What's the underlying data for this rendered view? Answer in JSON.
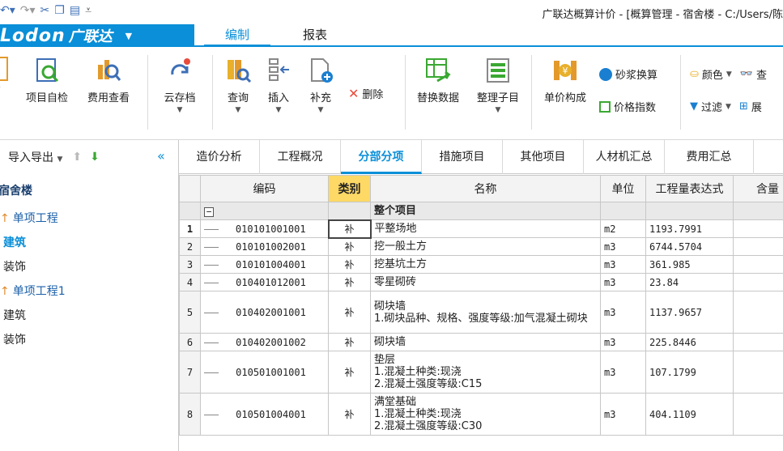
{
  "window": {
    "title": "广联达概算计价 - [概算管理 - 宿舍楼 - C:/Users/陈"
  },
  "brand": {
    "logo": "Lodon",
    "name": "广联达"
  },
  "menu": {
    "tabs": [
      "编制",
      "报表"
    ],
    "active": "编制"
  },
  "ribbon": {
    "buttons": [
      {
        "label": "项目自检"
      },
      {
        "label": "费用查看"
      },
      {
        "label": "云存档"
      },
      {
        "label": "查询"
      },
      {
        "label": "插入"
      },
      {
        "label": "补充"
      },
      {
        "label": "替换数据"
      },
      {
        "label": "整理子目"
      },
      {
        "label": "单价构成"
      }
    ],
    "delete_label": "删除",
    "mortar_label": "砂浆换算",
    "price_index_label": "价格指数",
    "color_label": "颜色",
    "filter_label": "过滤",
    "find_label": "查",
    "show_label": "展"
  },
  "left_panel": {
    "import_export_label": "导入导出",
    "project": "宿舍楼",
    "tree": [
      {
        "label": "单项工程",
        "kind": "unit"
      },
      {
        "label": "建筑",
        "kind": "bold"
      },
      {
        "label": "装饰",
        "kind": "normal"
      },
      {
        "label": "单项工程1",
        "kind": "unit"
      },
      {
        "label": "建筑",
        "kind": "normal"
      },
      {
        "label": "装饰",
        "kind": "normal"
      }
    ]
  },
  "content_tabs": [
    "造价分析",
    "工程概况",
    "分部分项",
    "措施项目",
    "其他项目",
    "人材机汇总",
    "费用汇总"
  ],
  "active_content_tab": "分部分项",
  "grid": {
    "headers": [
      "编码",
      "类别",
      "名称",
      "单位",
      "工程量表达式",
      "含量"
    ],
    "group_label": "整个项目",
    "rows": [
      {
        "no": "1",
        "code": "010101001001",
        "cat": "补",
        "name": "平整场地",
        "unit": "m2",
        "qty": "1193.7991"
      },
      {
        "no": "2",
        "code": "010101002001",
        "cat": "补",
        "name": "挖一般土方",
        "unit": "m3",
        "qty": "6744.5704"
      },
      {
        "no": "3",
        "code": "010101004001",
        "cat": "补",
        "name": "挖基坑土方",
        "unit": "m3",
        "qty": "361.985"
      },
      {
        "no": "4",
        "code": "010401012001",
        "cat": "补",
        "name": "零星砌砖",
        "unit": "m3",
        "qty": "23.84"
      },
      {
        "no": "5",
        "code": "010402001001",
        "cat": "补",
        "name": "砌块墙\n1.砌块品种、规格、强度等级:加气混凝土砌块",
        "unit": "m3",
        "qty": "1137.9657"
      },
      {
        "no": "6",
        "code": "010402001002",
        "cat": "补",
        "name": "砌块墙",
        "unit": "m3",
        "qty": "225.8446"
      },
      {
        "no": "7",
        "code": "010501001001",
        "cat": "补",
        "name": "垫层\n1.混凝土种类:现浇\n2.混凝土强度等级:C15",
        "unit": "m3",
        "qty": "107.1799"
      },
      {
        "no": "8",
        "code": "010501004001",
        "cat": "补",
        "name": "满堂基础\n1.混凝土种类:现浇\n2.混凝土强度等级:C30",
        "unit": "m3",
        "qty": "404.1109"
      }
    ]
  },
  "colors": {
    "accent": "#0a8fd8",
    "active_header": "#ffd966",
    "row_header": "#f3f3f3"
  }
}
